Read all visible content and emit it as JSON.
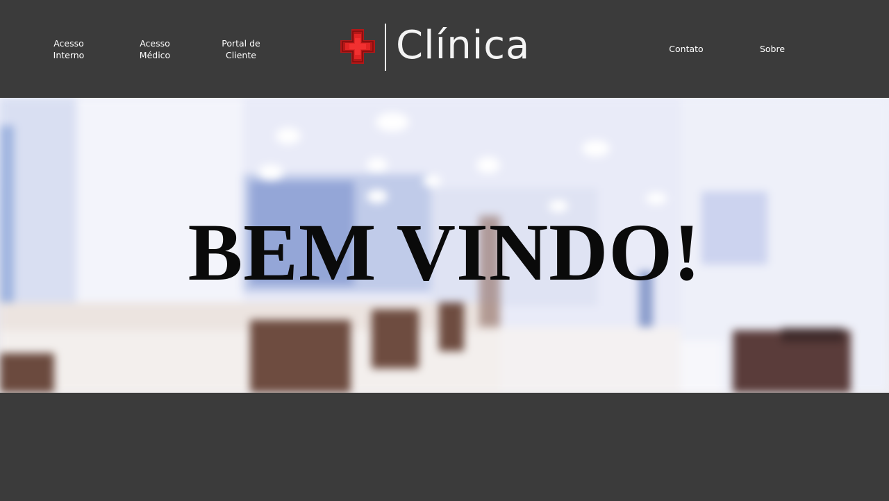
{
  "header": {
    "nav_left": [
      {
        "label": "Acesso\nInterno"
      },
      {
        "label": "Acesso\nMédico"
      },
      {
        "label": "Portal de\nCliente"
      }
    ],
    "logo_text": "Clínica",
    "nav_right": [
      {
        "label": "Contato"
      },
      {
        "label": "Sobre"
      }
    ]
  },
  "hero": {
    "title": "BEM VINDO!"
  },
  "colors": {
    "background": "#3b3b3b",
    "nav_text": "#ffffff",
    "logo_cross": "#d81e1e",
    "hero_text": "#0a0a0a"
  },
  "icons": {
    "logo_icon": "red-cross-icon"
  }
}
